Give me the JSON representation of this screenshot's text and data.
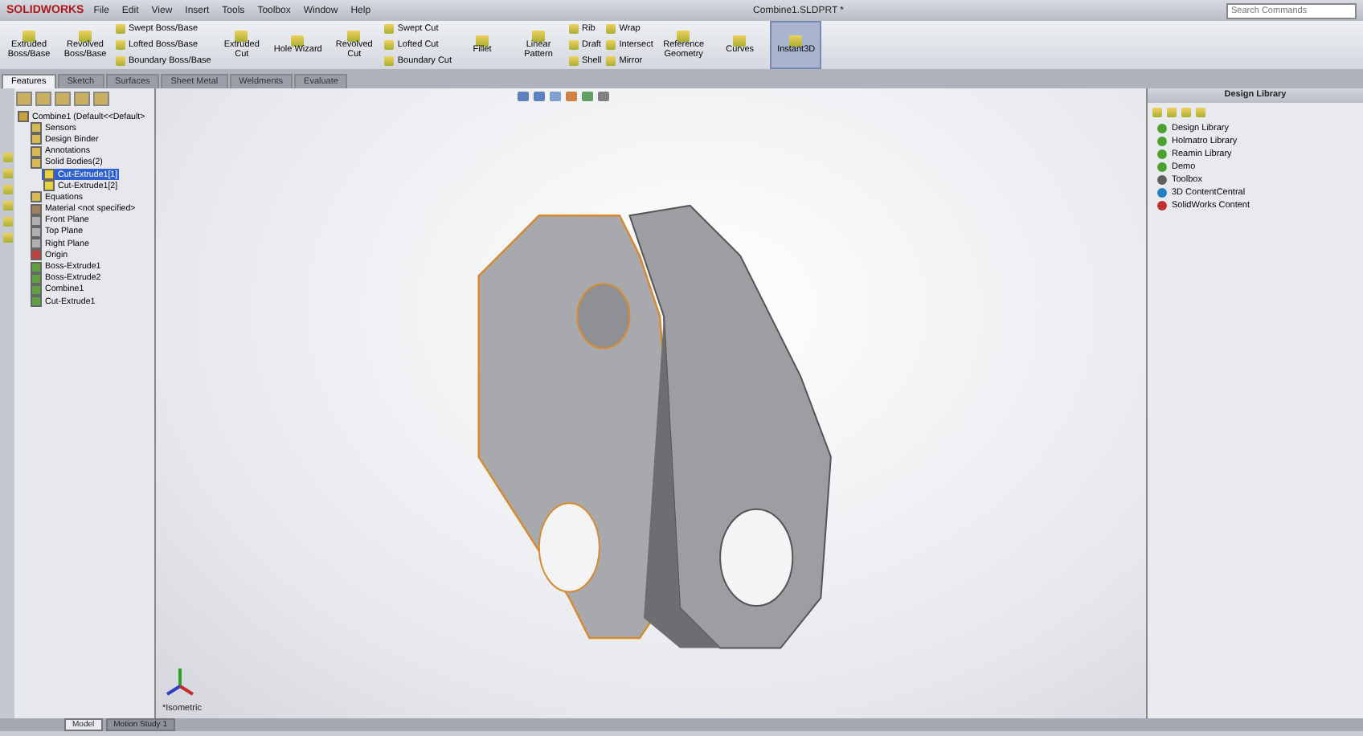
{
  "app": {
    "logo": "SOLIDWORKS",
    "menu": [
      "File",
      "Edit",
      "View",
      "Insert",
      "Tools",
      "Toolbox",
      "Window",
      "Help"
    ],
    "title": "Combine1.SLDPRT *",
    "search": {
      "placeholder": "Search Commands"
    }
  },
  "ribbon": [
    {
      "kind": "large",
      "label": "Extruded Boss/Base",
      "selected": false
    },
    {
      "kind": "large",
      "label": "Revolved Boss/Base",
      "selected": false
    },
    {
      "kind": "stack",
      "items": [
        "Swept Boss/Base",
        "Lofted Boss/Base",
        "Boundary Boss/Base"
      ]
    },
    {
      "kind": "large",
      "label": "Extruded Cut",
      "selected": false
    },
    {
      "kind": "large",
      "label": "Hole Wizard",
      "selected": false
    },
    {
      "kind": "large",
      "label": "Revolved Cut",
      "selected": false
    },
    {
      "kind": "stack",
      "items": [
        "Swept Cut",
        "Lofted Cut",
        "Boundary Cut"
      ]
    },
    {
      "kind": "large",
      "label": "Fillet",
      "selected": false
    },
    {
      "kind": "large",
      "label": "Linear Pattern",
      "selected": false
    },
    {
      "kind": "stack",
      "items": [
        "Rib",
        "Draft",
        "Shell"
      ]
    },
    {
      "kind": "stack",
      "items": [
        "Wrap",
        "Intersect",
        "Mirror"
      ]
    },
    {
      "kind": "large",
      "label": "Reference Geometry",
      "selected": false
    },
    {
      "kind": "large",
      "label": "Curves",
      "selected": false
    },
    {
      "kind": "large",
      "label": "Instant3D",
      "selected": true
    }
  ],
  "tabs": [
    {
      "label": "Features",
      "selected": true
    },
    {
      "label": "Sketch",
      "selected": false
    },
    {
      "label": "Surfaces",
      "selected": false
    },
    {
      "label": "Sheet Metal",
      "selected": false
    },
    {
      "label": "Weldments",
      "selected": false
    },
    {
      "label": "Evaluate",
      "selected": false
    }
  ],
  "feature_tree": {
    "root": "Combine1  (Default<<Default>",
    "items": [
      {
        "label": "Sensors",
        "selected": false,
        "color": "#d8b850"
      },
      {
        "label": "Design Binder",
        "selected": false,
        "color": "#d8b850"
      },
      {
        "label": "Annotations",
        "selected": false,
        "color": "#d8b850"
      },
      {
        "label": "Solid Bodies(2)",
        "selected": false,
        "color": "#d8b850",
        "children": [
          {
            "label": "Cut-Extrude1[1]",
            "selected": true,
            "color": "#e8d040"
          },
          {
            "label": "Cut-Extrude1[2]",
            "selected": false,
            "color": "#e8d040"
          }
        ]
      },
      {
        "label": "Equations",
        "selected": false,
        "color": "#d8b850"
      },
      {
        "label": "Material <not specified>",
        "selected": false,
        "color": "#a08060"
      },
      {
        "label": "Front Plane",
        "selected": false,
        "color": "#b0b0b0"
      },
      {
        "label": "Top Plane",
        "selected": false,
        "color": "#b0b0b0"
      },
      {
        "label": "Right Plane",
        "selected": false,
        "color": "#b0b0b0"
      },
      {
        "label": "Origin",
        "selected": false,
        "color": "#c04040"
      },
      {
        "label": "Boss-Extrude1",
        "selected": false,
        "color": "#60a040"
      },
      {
        "label": "Boss-Extrude2",
        "selected": false,
        "color": "#60a040"
      },
      {
        "label": "Combine1",
        "selected": false,
        "color": "#60a040"
      },
      {
        "label": "Cut-Extrude1",
        "selected": false,
        "color": "#60a040"
      }
    ]
  },
  "viewport": {
    "view_name": "*Isometric"
  },
  "design_library": {
    "title": "Design Library",
    "items": [
      {
        "label": "Design Library",
        "color": "#50a030"
      },
      {
        "label": "Holmatro Library",
        "color": "#50a030"
      },
      {
        "label": "Reamin Library",
        "color": "#50a030"
      },
      {
        "label": "Demo",
        "color": "#50a030"
      },
      {
        "label": "Toolbox",
        "color": "#606060"
      },
      {
        "label": "3D ContentCentral",
        "color": "#2080c0"
      },
      {
        "label": "SolidWorks Content",
        "color": "#c03030"
      }
    ]
  },
  "bottom_tabs": [
    {
      "label": "Model",
      "selected": true
    },
    {
      "label": "Motion Study 1",
      "selected": false
    }
  ]
}
